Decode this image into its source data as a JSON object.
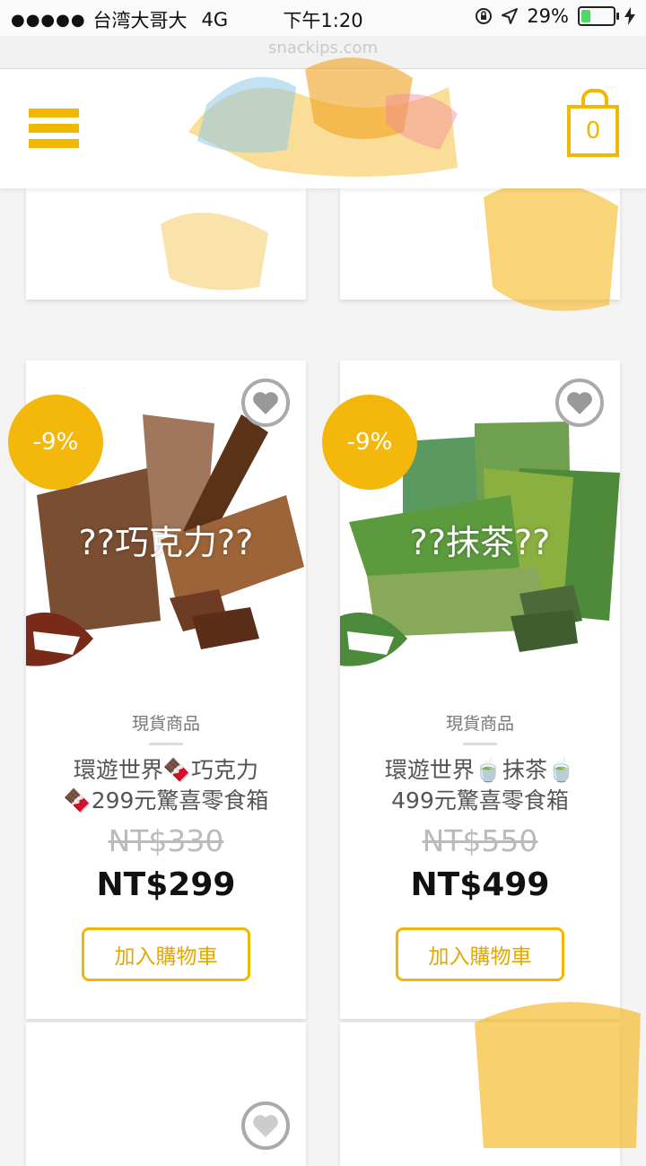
{
  "status_bar": {
    "signal": "●●●●●",
    "carrier": "台湾大哥大",
    "network": "4G",
    "time": "下午1:20",
    "battery_text": "29%",
    "battery_level": 0.29
  },
  "url_bar": {
    "text": "snackips.com"
  },
  "header": {
    "menu_icon": "hamburger-menu-icon",
    "cart_icon": "shopping-bag-icon",
    "cart_count": "0",
    "brand_color": "#f0b800"
  },
  "products": [
    {
      "discount": "-9%",
      "image_text": "??巧克力??",
      "category": "現貨商品",
      "title_line1": "環遊世界🍫巧克力",
      "title_line2": "🍫299元驚喜零食箱",
      "old_price": "NT$330",
      "new_price": "NT$299",
      "button": "加入購物車",
      "theme_color": "#7a4e32"
    },
    {
      "discount": "-9%",
      "image_text": "??抹茶??",
      "category": "現貨商品",
      "title_line1": "環遊世界🍵抹茶🍵",
      "title_line2": "499元驚喜零食箱",
      "old_price": "NT$550",
      "new_price": "NT$499",
      "button": "加入購物車",
      "theme_color": "#5a9a3e"
    }
  ],
  "icons": {
    "wishlist": "heart-icon"
  }
}
